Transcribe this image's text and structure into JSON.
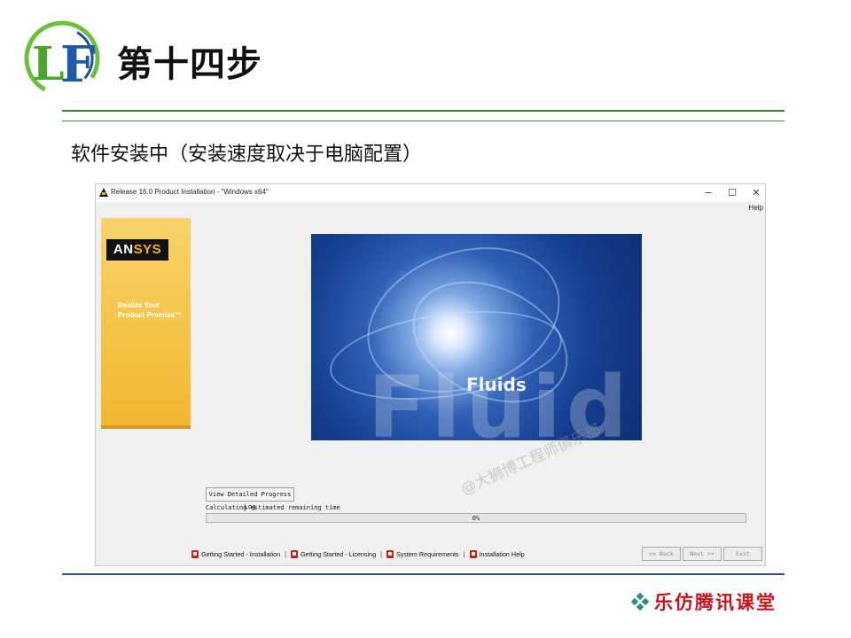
{
  "slide": {
    "title": "第十四步",
    "subtitle": "软件安装中（安装速度取决于电脑配置）",
    "brand": "乐仿腾讯课堂",
    "watermark": "@大狮博工程师俱乐部"
  },
  "colors": {
    "accent_green": "#2f8a2f",
    "footer_blue": "#2c4f8a",
    "brand_red": "#c3151b",
    "ansys_gold": "#f2b21b",
    "progress_green": "#06b025"
  },
  "window": {
    "title": "Release 16.0 Product Installation - \"Windows x64\"",
    "icon": "ansys-a-icon",
    "controls": {
      "minimize": "−",
      "maximize": "☐",
      "close": "✕"
    },
    "menu": {
      "help": "Help"
    },
    "sidebar": {
      "logo_text_left": "AN",
      "logo_text_right": "SYS",
      "tagline_line1": "Realize Your",
      "tagline_line2": "Product Promise™"
    },
    "banner": {
      "title": "Fluids",
      "background_word": "Fluid"
    },
    "log_button": "View Detailed Progress Log",
    "status": "Calculating estimated remaining time",
    "progress": {
      "label": "0%",
      "fraction": 0
    },
    "links": [
      {
        "label": "Getting Started - Installation",
        "icon": "pdf-icon"
      },
      {
        "label": "Getting Started - Licensing",
        "icon": "pdf-icon"
      },
      {
        "label": "System Requirements",
        "icon": "pdf-icon"
      },
      {
        "label": "Installation Help",
        "icon": "pdf-icon"
      }
    ],
    "link_separator": "|",
    "nav": {
      "back": "<< Back",
      "next": "Next >>",
      "exit": "Exit"
    }
  }
}
